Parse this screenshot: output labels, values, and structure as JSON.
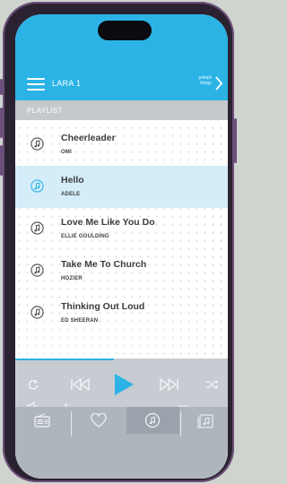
{
  "header": {
    "title": "LARA 1",
    "link_line1": "pokaži",
    "link_line2": "fotogr"
  },
  "playlist": {
    "label": "PLAYLIST"
  },
  "songs": [
    {
      "title": "Cheerleader",
      "artist": "OMI",
      "active": false
    },
    {
      "title": "Hello",
      "artist": "ADELE",
      "active": true
    },
    {
      "title": "Love Me Like You Do",
      "artist": "ELLIE GOULDING",
      "active": false
    },
    {
      "title": "Take Me To Church",
      "artist": "HOZIER",
      "active": false
    },
    {
      "title": "Thinking Out Loud",
      "artist": "ED SHEERAN",
      "active": false
    }
  ],
  "controls": {
    "repeat_icon": "repeat-icon",
    "prev_icon": "previous-track-icon",
    "play_icon": "play-icon",
    "next_icon": "next-track-icon",
    "shuffle_icon": "shuffle-icon",
    "volume_icon": "speaker-icon",
    "volume_plus": "+",
    "volume_minus": "—",
    "volume_level": 0.5
  },
  "tabs": [
    {
      "icon": "radio-icon",
      "active": false
    },
    {
      "icon": "heart-icon",
      "active": false
    },
    {
      "icon": "music-disc-icon",
      "active": true
    },
    {
      "icon": "music-library-icon",
      "active": false
    }
  ],
  "colors": {
    "accent": "#2bb3e6",
    "active_row": "#d5ecf9",
    "control_bar": "#c6ccd2",
    "tab_bar": "#aeb5bd",
    "phone_frame": "#6b4f7a"
  }
}
